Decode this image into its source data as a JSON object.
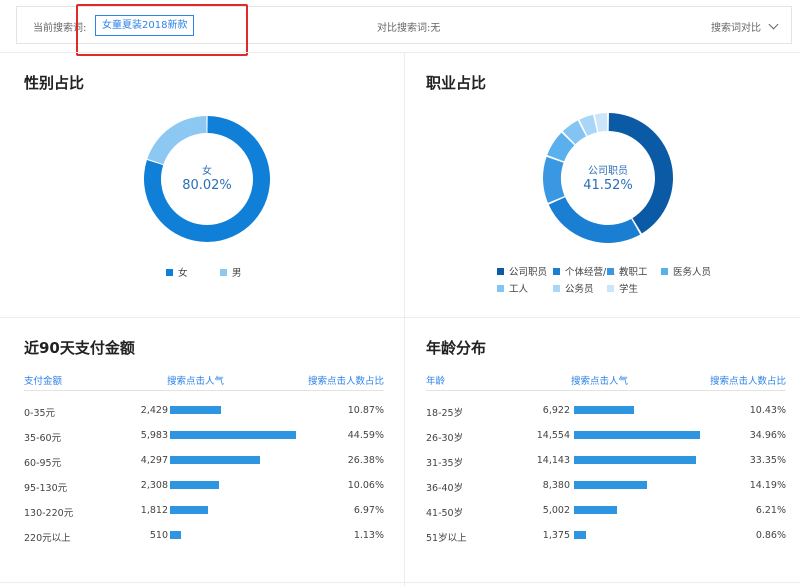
{
  "search_bar": {
    "current_label": "当前搜索词:",
    "current_keyword": "女童夏装2018新款",
    "compare_label": "对比搜索词:无",
    "compare_button": "搜索词对比"
  },
  "gender": {
    "title": "性别占比",
    "center_label": "女",
    "center_value": "80.02%",
    "slices": [
      {
        "name": "女",
        "value": 80.02,
        "color": "#0f7fd8"
      },
      {
        "name": "男",
        "value": 19.98,
        "color": "#8dc8f3"
      }
    ]
  },
  "occupation": {
    "title": "职业占比",
    "center_label": "公司职员",
    "center_value": "41.52%",
    "slices": [
      {
        "name": "公司职员",
        "value": 41.52,
        "color": "#0b5aa6"
      },
      {
        "name": "个体经营/...",
        "value": 27.0,
        "color": "#1a7fd2"
      },
      {
        "name": "教职工",
        "value": 12.0,
        "color": "#3a98e3"
      },
      {
        "name": "医务人员",
        "value": 7.0,
        "color": "#5ab0ec"
      },
      {
        "name": "工人",
        "value": 5.0,
        "color": "#83c4f2"
      },
      {
        "name": "公务员",
        "value": 4.0,
        "color": "#a9d6f6"
      },
      {
        "name": "学生",
        "value": 3.48,
        "color": "#cbe6fa"
      }
    ]
  },
  "payment": {
    "title": "近90天支付金额",
    "headers": [
      "支付金额",
      "搜索点击人气",
      "搜索点击人数占比"
    ],
    "rows": [
      {
        "label": "0-35元",
        "popularity": "2,429",
        "popularity_num": 2429,
        "share": "10.87%"
      },
      {
        "label": "35-60元",
        "popularity": "5,983",
        "popularity_num": 5983,
        "share": "44.59%"
      },
      {
        "label": "60-95元",
        "popularity": "4,297",
        "popularity_num": 4297,
        "share": "26.38%"
      },
      {
        "label": "95-130元",
        "popularity": "2,308",
        "popularity_num": 2308,
        "share": "10.06%"
      },
      {
        "label": "130-220元",
        "popularity": "1,812",
        "popularity_num": 1812,
        "share": "6.97%"
      },
      {
        "label": "220元以上",
        "popularity": "510",
        "popularity_num": 510,
        "share": "1.13%"
      }
    ]
  },
  "age": {
    "title": "年龄分布",
    "headers": [
      "年龄",
      "搜索点击人气",
      "搜索点击人数占比"
    ],
    "rows": [
      {
        "label": "18-25岁",
        "popularity": "6,922",
        "popularity_num": 6922,
        "share": "10.43%"
      },
      {
        "label": "26-30岁",
        "popularity": "14,554",
        "popularity_num": 14554,
        "share": "34.96%"
      },
      {
        "label": "31-35岁",
        "popularity": "14,143",
        "popularity_num": 14143,
        "share": "33.35%"
      },
      {
        "label": "36-40岁",
        "popularity": "8,380",
        "popularity_num": 8380,
        "share": "14.19%"
      },
      {
        "label": "41-50岁",
        "popularity": "5,002",
        "popularity_num": 5002,
        "share": "6.21%"
      },
      {
        "label": "51岁以上",
        "popularity": "1,375",
        "popularity_num": 1375,
        "share": "0.86%"
      }
    ]
  }
}
